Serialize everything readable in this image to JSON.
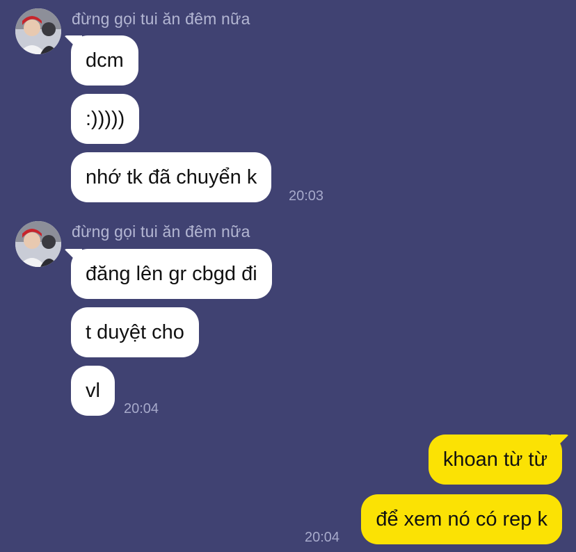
{
  "groups": [
    {
      "sender": "đừng gọi tui ăn đêm nữa",
      "messages": [
        "dcm",
        ":)))))",
        "nhớ tk đã chuyển k"
      ],
      "time": "20:03"
    },
    {
      "sender": "đừng gọi tui ăn đêm nữa",
      "messages": [
        "đăng lên gr cbgd đi",
        "t duyệt cho",
        "vl"
      ],
      "time": "20:04"
    }
  ],
  "outgoing": {
    "messages": [
      "khoan từ từ",
      "để xem nó có rep k"
    ],
    "time": "20:04"
  },
  "colors": {
    "background": "#404272",
    "incoming_bubble": "#ffffff",
    "outgoing_bubble": "#fbe204"
  }
}
